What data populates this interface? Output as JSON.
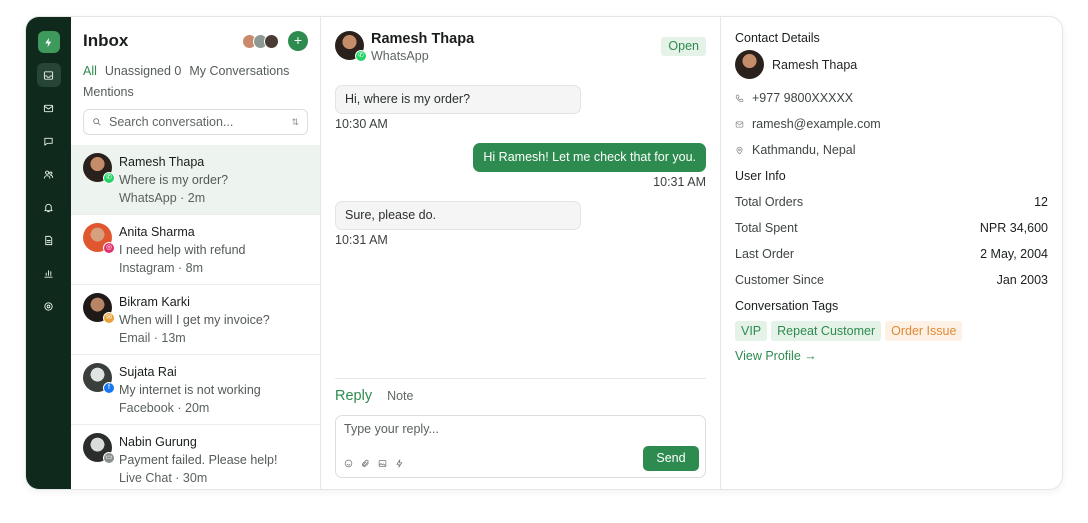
{
  "colors": {
    "accent": "#2e8b4f",
    "rail": "#0f2a1c",
    "orange": "#e08a35"
  },
  "rail": {
    "items": [
      {
        "icon": "inbox-icon",
        "active": true
      },
      {
        "icon": "mail-icon"
      },
      {
        "icon": "chat-icon"
      },
      {
        "icon": "users-icon"
      },
      {
        "icon": "bell-icon"
      },
      {
        "icon": "document-icon"
      },
      {
        "icon": "chart-icon"
      },
      {
        "icon": "settings-icon"
      }
    ]
  },
  "inbox": {
    "title": "Inbox",
    "add_label": "+",
    "filters": [
      "All",
      "Unassigned 0",
      "My Conversations",
      "Mentions"
    ],
    "search_placeholder": "Search conversation...",
    "conversations": [
      {
        "name": "Ramesh Thapa",
        "message": "Where is my order?",
        "meta": "WhatsApp · 2m",
        "channel": "whatsapp",
        "selected": true
      },
      {
        "name": "Anita Sharma",
        "message": "I need help with refund",
        "meta": "Instagram · 8m",
        "channel": "instagram"
      },
      {
        "name": "Bikram Karki",
        "message": "When will I get my invoice?",
        "meta": "Email · 13m",
        "channel": "email"
      },
      {
        "name": "Sujata Rai",
        "message": "My internet is not working",
        "meta": "Facebook · 20m",
        "channel": "facebook"
      },
      {
        "name": "Nabin Gurung",
        "message": "Payment failed. Please help!",
        "meta": "Live Chat · 30m",
        "channel": "livechat"
      }
    ]
  },
  "chat": {
    "name": "Ramesh Thapa",
    "channel": "WhatsApp",
    "status": "Open",
    "messages": [
      {
        "text": "Hi, where is my order?",
        "time": "10:30 AM",
        "direction": "in"
      },
      {
        "text": "Hi Ramesh! Let me check that for you.",
        "time": "10:31 AM",
        "direction": "out"
      },
      {
        "text": "Sure, please do.",
        "time": "10:31 AM",
        "direction": "in"
      }
    ],
    "reply_tab": "Reply",
    "note_tab": "Note",
    "composer_placeholder": "Type your reply...",
    "send_label": "Send"
  },
  "details": {
    "contact_heading": "Contact Details",
    "name": "Ramesh Thapa",
    "phone": "+977 9800XXXXX",
    "email": "ramesh@example.com",
    "location": "Kathmandu, Nepal",
    "user_info_heading": "User Info",
    "stats": [
      {
        "label": "Total Orders",
        "value": "12"
      },
      {
        "label": "Total Spent",
        "value": "NPR 34,600"
      },
      {
        "label": "Last Order",
        "value": "2 May, 2004"
      },
      {
        "label": "Customer Since",
        "value": "Jan 2003"
      }
    ],
    "tags_heading": "Conversation Tags",
    "tags": [
      {
        "label": "VIP",
        "color": "green"
      },
      {
        "label": "Repeat Customer",
        "color": "green"
      },
      {
        "label": "Order Issue",
        "color": "orange"
      }
    ],
    "view_profile": "View Profile →"
  }
}
